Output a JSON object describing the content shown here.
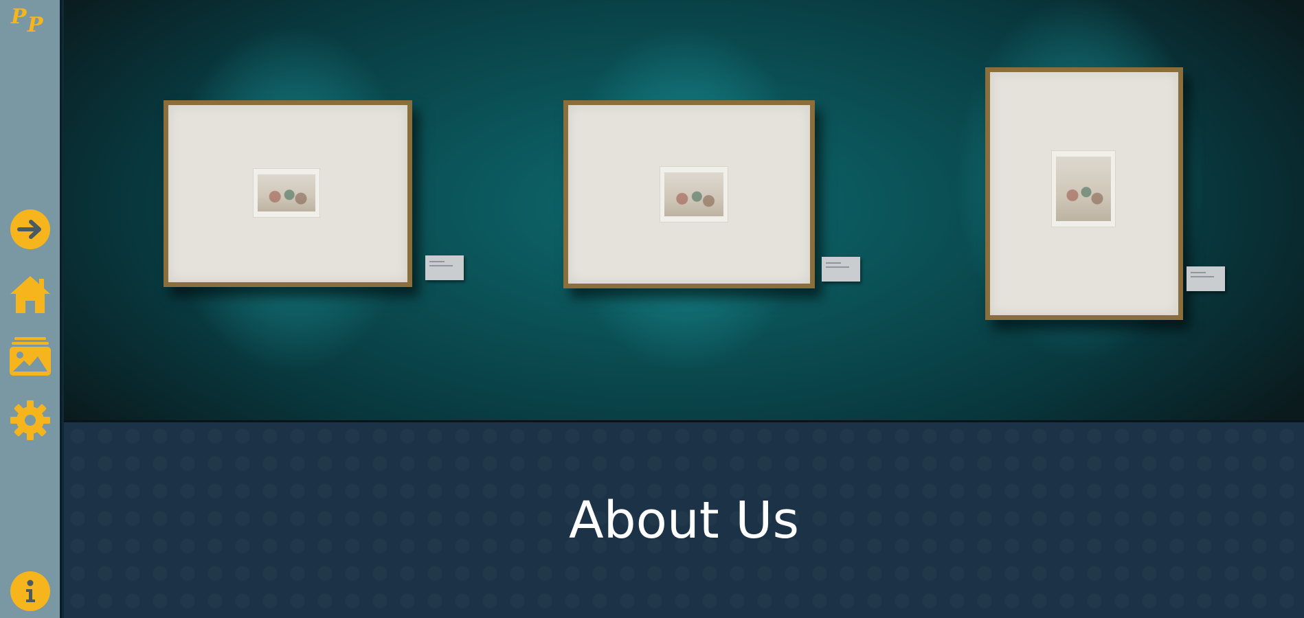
{
  "app": {
    "logo_text": "PP",
    "accent_color": "#f6b51c",
    "sidebar_color": "#7a98a3"
  },
  "sidebar": {
    "items": [
      {
        "id": "login",
        "icon": "arrow-right-circle-icon"
      },
      {
        "id": "home",
        "icon": "home-icon"
      },
      {
        "id": "gallery",
        "icon": "images-icon"
      },
      {
        "id": "settings",
        "icon": "gear-icon"
      },
      {
        "id": "info",
        "icon": "info-icon"
      }
    ]
  },
  "hero": {
    "image_description_icons": [
      "framed-artwork",
      "framed-artwork",
      "framed-artwork"
    ]
  },
  "about": {
    "title": "About Us"
  }
}
